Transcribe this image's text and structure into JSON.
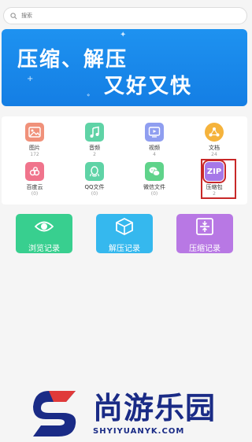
{
  "search": {
    "placeholder": "搜索"
  },
  "banner": {
    "line1": "压缩、解压",
    "line2": "又好又快"
  },
  "categories": [
    {
      "label": "图片",
      "count": "172",
      "icon": "image-icon",
      "color": "#f0917a"
    },
    {
      "label": "音频",
      "count": "2",
      "icon": "music-icon",
      "color": "#5fd3a6"
    },
    {
      "label": "视频",
      "count": "4",
      "icon": "video-icon",
      "color": "#8f9ef0"
    },
    {
      "label": "文档",
      "count": "24",
      "icon": "document-icon",
      "color": "#f5b33c"
    },
    {
      "label": "百度云",
      "count": "(0)",
      "icon": "baidu-cloud-icon",
      "color": "#f0748c"
    },
    {
      "label": "QQ文件",
      "count": "(0)",
      "icon": "qq-icon",
      "color": "#5fd3a6"
    },
    {
      "label": "微信文件",
      "count": "(0)",
      "icon": "wechat-icon",
      "color": "#5fd38a"
    },
    {
      "label": "压缩包",
      "count": "2",
      "icon": "zip-icon",
      "color": "#a678e8",
      "glyph": "ZIP"
    }
  ],
  "actions": [
    {
      "label": "浏览记录",
      "icon": "eye-icon",
      "color": "#38cf8f"
    },
    {
      "label": "解压记录",
      "icon": "box-icon",
      "color": "#35b8ee"
    },
    {
      "label": "压缩记录",
      "icon": "compress-icon",
      "color": "#b878e4"
    }
  ],
  "watermark": {
    "brand": "尚游乐园",
    "url": "SHYIYUANYK.COM"
  },
  "colors": {
    "highlight": "#c82828",
    "banner": "#1e8af0"
  }
}
